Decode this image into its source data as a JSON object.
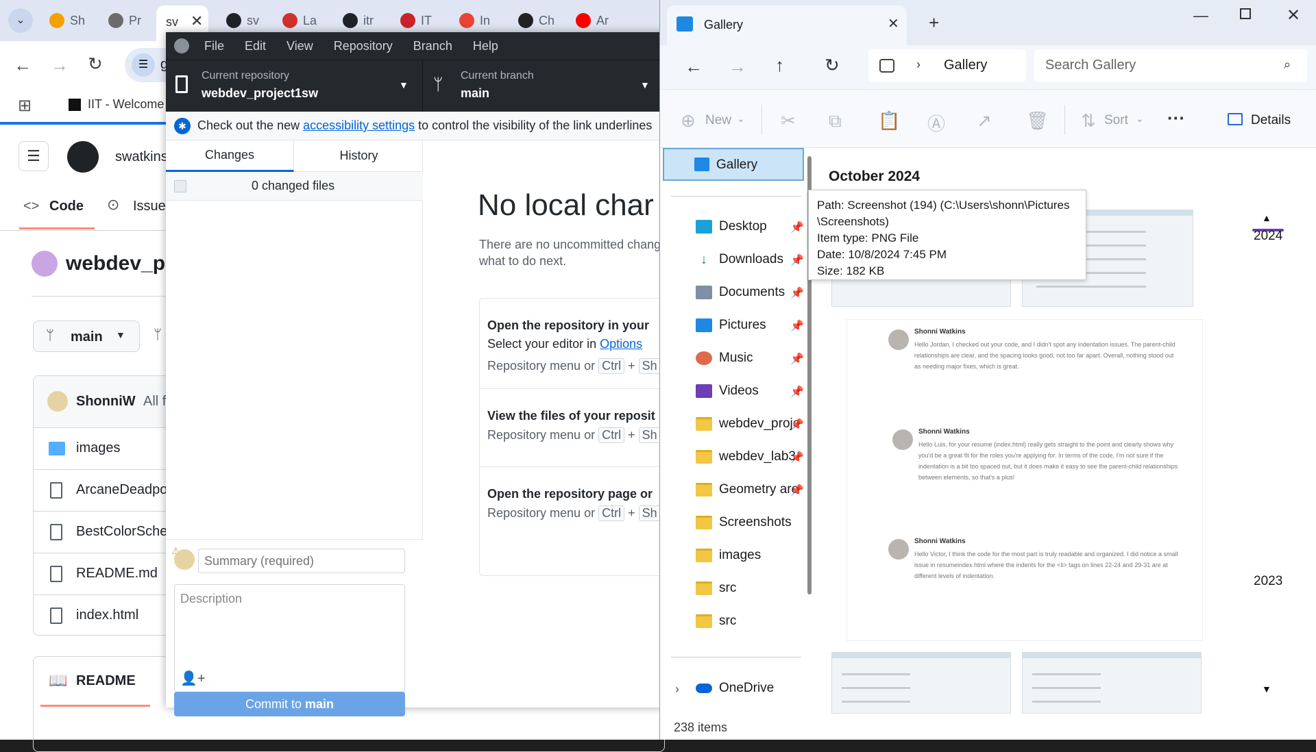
{
  "chrome": {
    "tabs": [
      {
        "label": "Sh",
        "color": "#f4a100"
      },
      {
        "label": "Pr",
        "color": "#6b6b6b"
      },
      {
        "label": "sv",
        "color": "#1f2328"
      },
      {
        "label": "sv",
        "color": "#1f2328"
      },
      {
        "label": "La",
        "color": "#d0312d"
      },
      {
        "label": "itr",
        "color": "#1f2328"
      },
      {
        "label": "IT",
        "color": "#cc2229"
      },
      {
        "label": "In",
        "color": "#ea4335"
      },
      {
        "label": "Ch",
        "color": "#222222"
      },
      {
        "label": "Ar",
        "color": "#ff0000"
      }
    ],
    "active_tab_label": "sv",
    "bookmark_label": "IIT - Welcome",
    "address_prefix": "g"
  },
  "github_page": {
    "owner": "swatkins",
    "tab_code": "Code",
    "tab_issues": "Issue",
    "repo_name": "webdev_pr",
    "branch": "main",
    "commit_author": "ShonniW",
    "commit_suffix": "All f",
    "files": [
      "images",
      "ArcaneDeadpo",
      "BestColorSche",
      "README.md",
      "index.html"
    ],
    "readme_label": "README"
  },
  "ghd": {
    "menu": [
      "File",
      "Edit",
      "View",
      "Repository",
      "Branch",
      "Help"
    ],
    "current_repo_label": "Current repository",
    "current_repo_value": "webdev_project1sw",
    "current_branch_label": "Current branch",
    "current_branch_value": "main",
    "banner_prefix": "Check out the new ",
    "banner_link": "accessibility settings",
    "banner_suffix": " to control the visibility of the link underlines",
    "tab_changes": "Changes",
    "tab_history": "History",
    "changed_files": "0 changed files",
    "summary_placeholder": "Summary (required)",
    "description_placeholder": "Description",
    "commit_prefix": "Commit to ",
    "commit_branch": "main",
    "no_changes_title": "No local char",
    "no_changes_line1": "There are no uncommitted chang",
    "no_changes_line2": "what to do next.",
    "suggestions": [
      {
        "title": "Open the repository in your",
        "desc_prefix": "Select your editor in ",
        "desc_link": "Options",
        "shortcut_prefix": "Repository menu or ",
        "shortcut_key1": "Ctrl",
        "shortcut_plus": "+",
        "shortcut_key2": "Sh"
      },
      {
        "title": "View the files of your reposit",
        "shortcut_prefix": "Repository menu or ",
        "shortcut_key1": "Ctrl",
        "shortcut_plus": "+",
        "shortcut_key2": "Sh"
      },
      {
        "title": "Open the repository page or",
        "shortcut_prefix": "Repository menu or ",
        "shortcut_key1": "Ctrl",
        "shortcut_plus": "+",
        "shortcut_key2": "Sh"
      }
    ]
  },
  "explorer": {
    "tab_title": "Gallery",
    "breadcrumb": "Gallery",
    "search_placeholder": "Search Gallery",
    "cmd_new": "New",
    "cmd_sort": "Sort",
    "cmd_details": "Details",
    "nav_selected": "Gallery",
    "nav_items": [
      {
        "label": "Desktop",
        "icon": "desktop-icon",
        "pinned": true
      },
      {
        "label": "Downloads",
        "icon": "downloads-icon",
        "pinned": true
      },
      {
        "label": "Documents",
        "icon": "documents-icon",
        "pinned": true
      },
      {
        "label": "Pictures",
        "icon": "pictures-icon",
        "pinned": true
      },
      {
        "label": "Music",
        "icon": "music-icon",
        "pinned": true
      },
      {
        "label": "Videos",
        "icon": "videos-icon",
        "pinned": true
      },
      {
        "label": "webdev_proje",
        "icon": "folder-icon",
        "pinned": true
      },
      {
        "label": "webdev_lab3",
        "icon": "folder-icon",
        "pinned": true
      },
      {
        "label": "Geometry are",
        "icon": "folder-icon",
        "pinned": true
      },
      {
        "label": "Screenshots",
        "icon": "folder-icon",
        "pinned": false
      },
      {
        "label": "images",
        "icon": "folder-icon",
        "pinned": false
      },
      {
        "label": "src",
        "icon": "folder-icon",
        "pinned": false
      },
      {
        "label": "src",
        "icon": "folder-icon",
        "pinned": false
      }
    ],
    "onedrive": "OneDrive",
    "month_heading": "October 2024",
    "year_2024": "2024",
    "year_2023": "2023",
    "status": "238 items",
    "tooltip": {
      "path": "Path: Screenshot (194) (C:\\Users\\shonn\\Pictures",
      "path2": "\\Screenshots)",
      "type": "Item type: PNG File",
      "date": "Date: 10/8/2024 7:45 PM",
      "size": "Size: 182 KB"
    },
    "comments": [
      {
        "name": "Shonni Watkins",
        "text": "Hello Jordan, I checked out your code, and I didn't spot any indentation issues. The parent-child relationships are clear, and the spacing looks good, not too far apart. Overall, nothing stood out as needing major fixes, which is great."
      },
      {
        "name": "Shonni Watkins",
        "text": "Hello Luis, for your resume (index.html) really gets straight to the point and clearly shows why you'd be a great fit for the roles you're applying for. In terms of the code, I'm not sure if the indentation is a bit too spaced out, but it does make it easy to see the parent-child relationships between elements, so that's a plus!"
      },
      {
        "name": "Shonni Watkins",
        "text": "Hello Victor, I think the code for the most part is truly readable and organized. I did notice a small issue in resumeindex.html where the indents for the <li> tags on lines 22-24 and 29-31 are at different levels of indentation."
      }
    ]
  }
}
